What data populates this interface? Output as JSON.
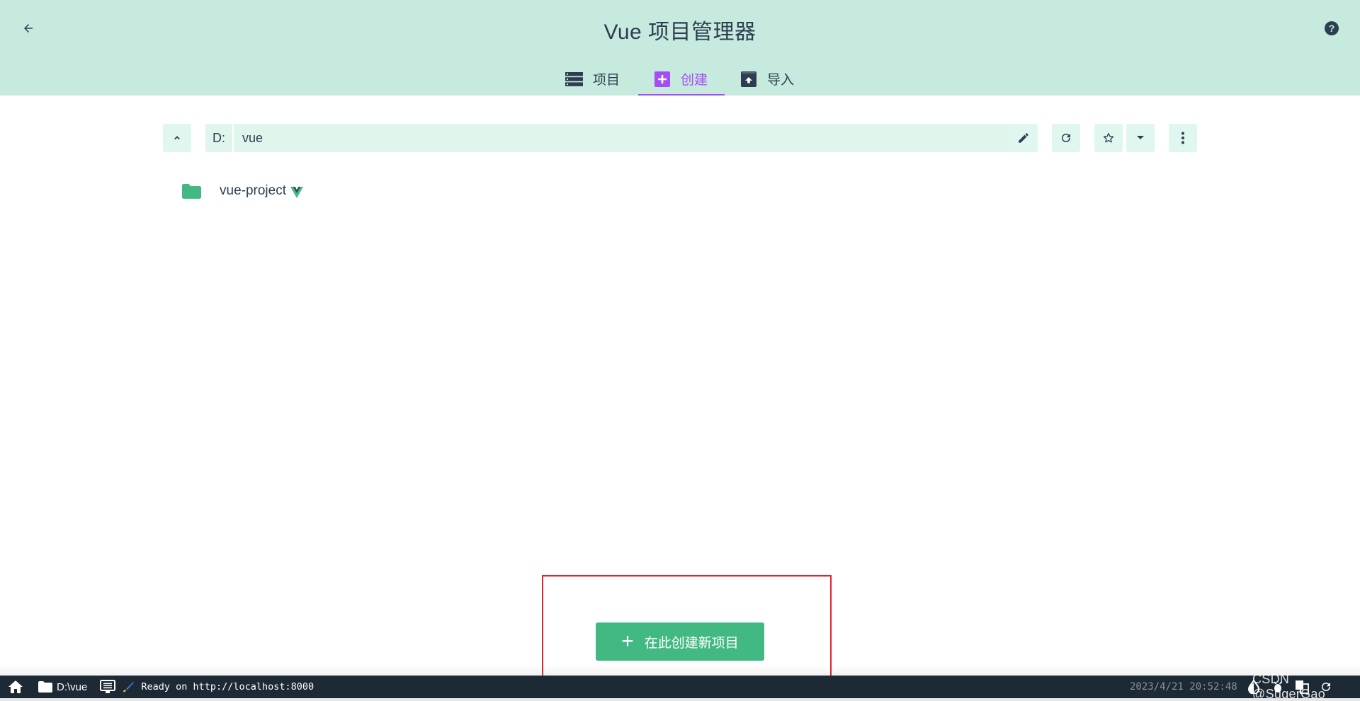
{
  "header": {
    "title": "Vue 项目管理器",
    "back_icon": "arrow-left-icon",
    "help_icon": "help-circle-icon",
    "help_glyph": "?",
    "tabs": [
      {
        "label": "项目",
        "icon": "list-icon",
        "active": false
      },
      {
        "label": "创建",
        "icon": "add-box-icon",
        "active": true
      },
      {
        "label": "导入",
        "icon": "unarchive-icon",
        "active": false
      }
    ],
    "accent_color": "#a44cf6",
    "background_color": "#c6eade"
  },
  "pathbar": {
    "up_icon": "chevron-up-icon",
    "drive": "D:",
    "path_value": "vue",
    "edit_icon": "pencil-icon",
    "refresh_icon": "refresh-icon",
    "favorite_icon": "star-outline-icon",
    "favorites_dropdown_icon": "caret-down-icon",
    "more_icon": "more-vertical-icon"
  },
  "folders": [
    {
      "name": "vue-project",
      "icon": "folder-icon",
      "is_vue_project": true
    }
  ],
  "create_button": {
    "label": "在此创建新项目",
    "plus": "+",
    "color": "#42b983"
  },
  "annotation": {
    "highlight_color": "#e3222b"
  },
  "statusbar": {
    "home_icon": "home-icon",
    "folder_path": "D:\\vue",
    "console_icon": "console-icon",
    "log_icon": "paint-brush-icon",
    "log_message": "Ready on http://localhost:8000",
    "timestamp": "2023/4/21 20:52:48",
    "right_icons": [
      "dark-mode-icon",
      "bug-icon",
      "translate-icon",
      "refresh-icon"
    ]
  },
  "watermark": "CSDN @SugerGao"
}
